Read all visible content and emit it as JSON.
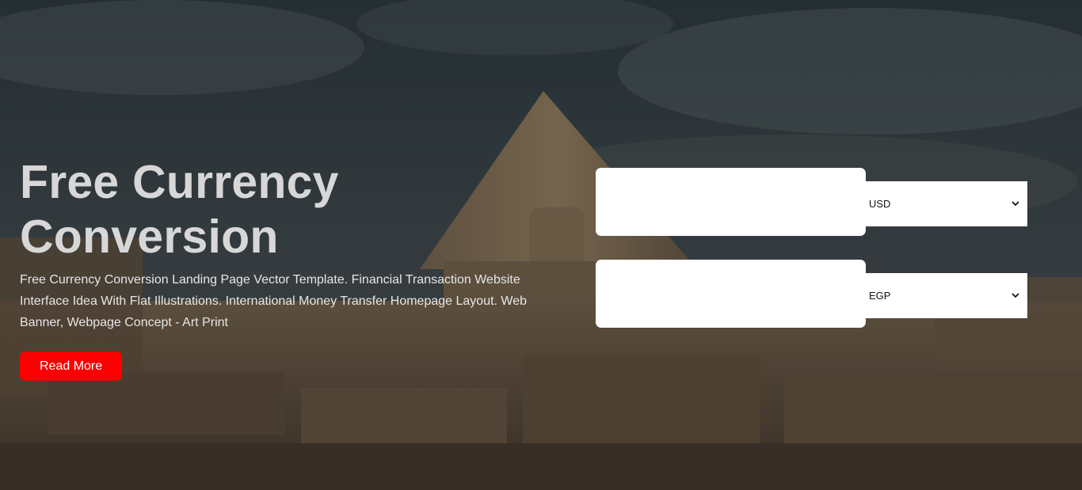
{
  "hero": {
    "title_line1": "Free Currency",
    "title_line2": "Conversion",
    "description": "Free Currency Conversion Landing Page Vector Template. Financial Transaction Website Interface Idea With Flat Illustrations. International Money Transfer Homepage Layout. Web Banner, Webpage Concept - Art Print",
    "cta_label": "Read More",
    "cta_color": "#fa0000",
    "background_icon": "pyramid-sphinx-photo"
  },
  "converter": {
    "from": {
      "amount_value": "",
      "currency_selected": "USD"
    },
    "to": {
      "amount_value": "",
      "currency_selected": "EGP"
    },
    "dropdown_icon": "chevron-down-icon"
  }
}
